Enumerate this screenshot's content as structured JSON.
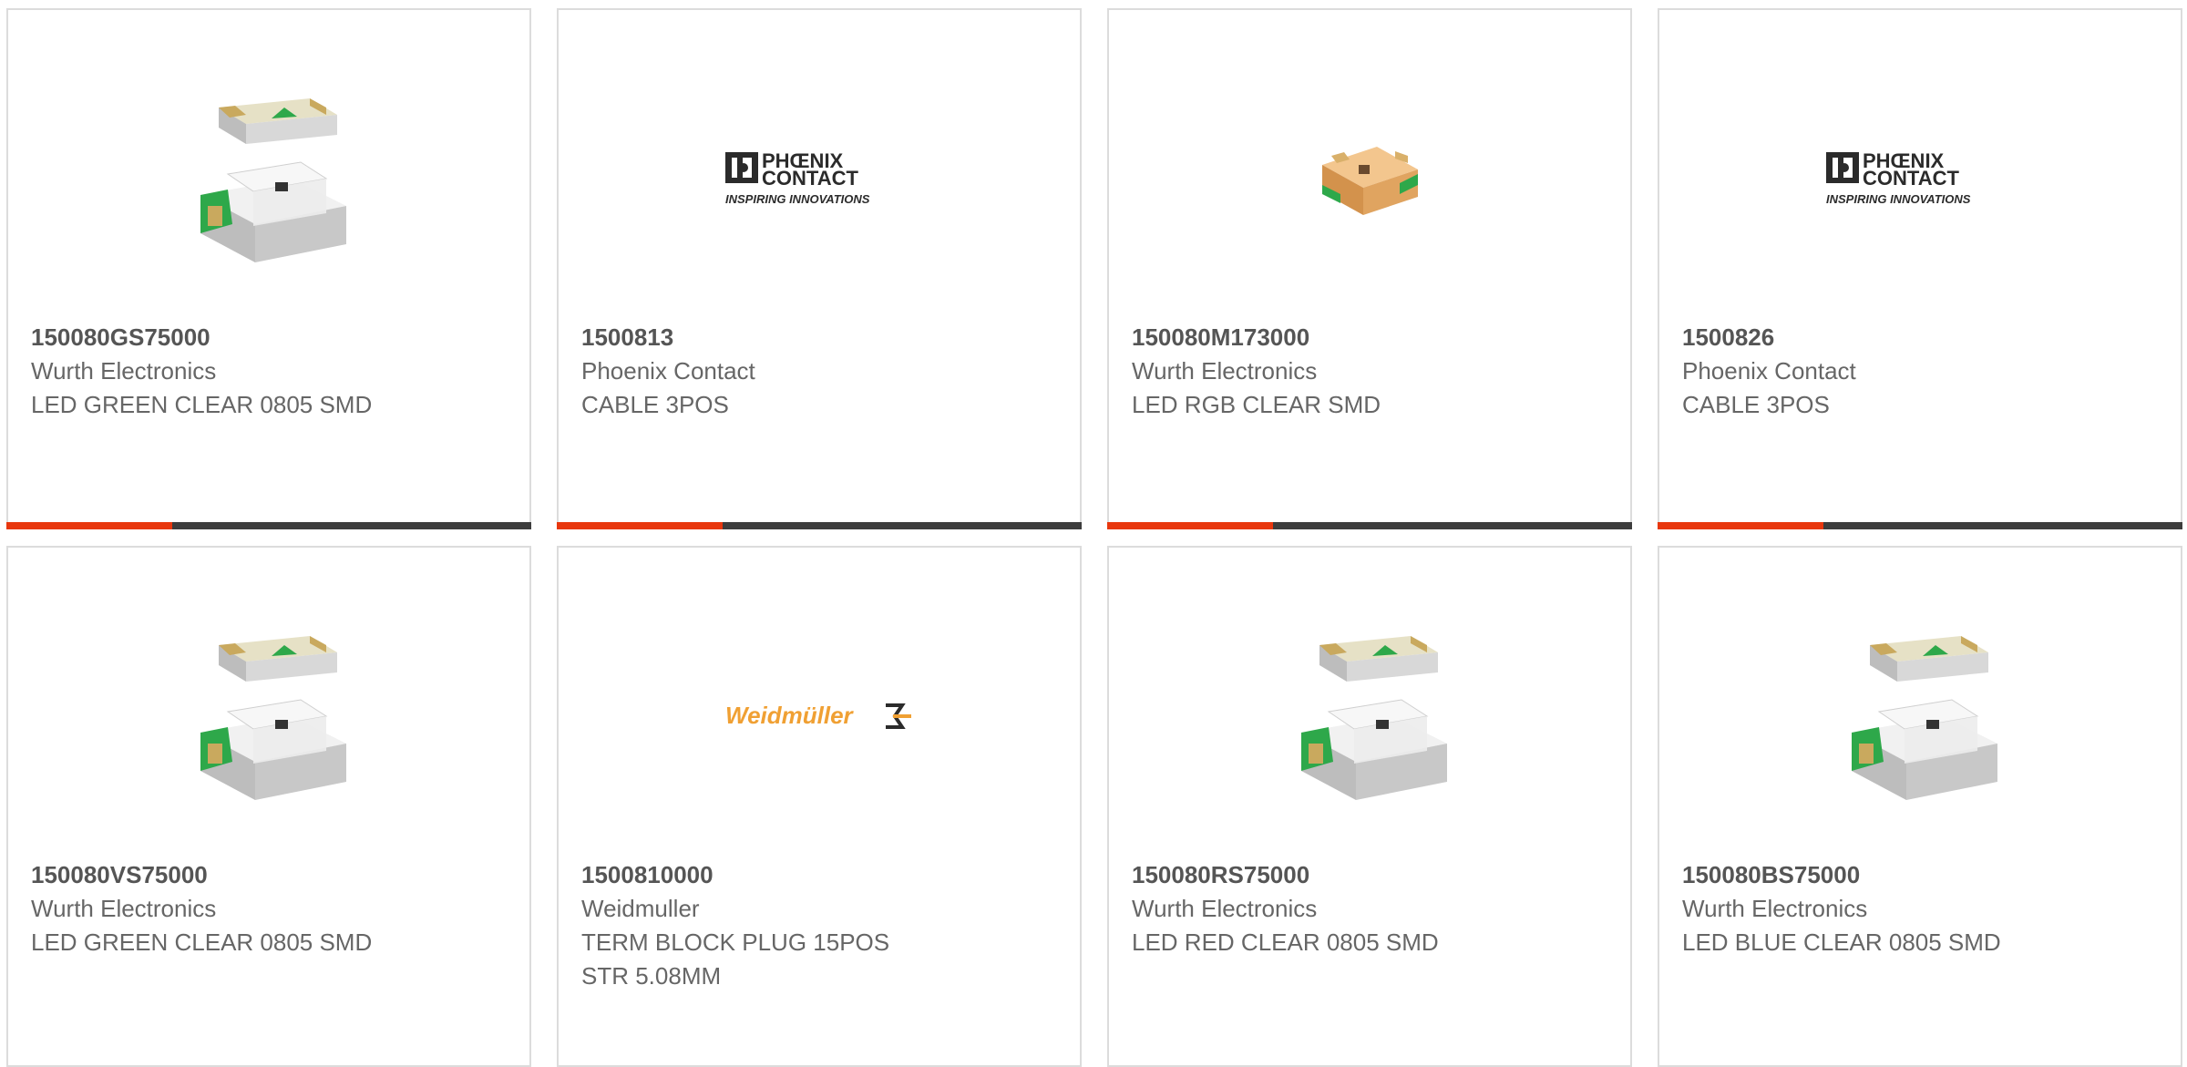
{
  "colors": {
    "accent": "#e8370e",
    "bar": "#3d3d3d",
    "border": "#dcdcdc"
  },
  "products": [
    {
      "part_number": "150080GS75000",
      "manufacturer": "Wurth Electronics",
      "desc1": "LED GREEN CLEAR 0805 SMD",
      "desc2": "",
      "image": "led-green-icon"
    },
    {
      "part_number": "1500813",
      "manufacturer": "Phoenix Contact",
      "desc1": "CABLE 3POS",
      "desc2": "",
      "image": "phoenix-contact-logo",
      "logo_line1": "PHŒNIX",
      "logo_line2": "CONTACT",
      "logo_tag": "INSPIRING INNOVATIONS"
    },
    {
      "part_number": "150080M173000",
      "manufacturer": "Wurth Electronics",
      "desc1": "LED RGB CLEAR SMD",
      "desc2": "",
      "image": "led-rgb-icon"
    },
    {
      "part_number": "1500826",
      "manufacturer": "Phoenix Contact",
      "desc1": "CABLE 3POS",
      "desc2": "",
      "image": "phoenix-contact-logo",
      "logo_line1": "PHŒNIX",
      "logo_line2": "CONTACT",
      "logo_tag": "INSPIRING INNOVATIONS"
    },
    {
      "part_number": "150080VS75000",
      "manufacturer": "Wurth Electronics",
      "desc1": "LED GREEN CLEAR 0805 SMD",
      "desc2": "",
      "image": "led-green-icon"
    },
    {
      "part_number": "1500810000",
      "manufacturer": "Weidmuller",
      "desc1": "TERM BLOCK PLUG 15POS",
      "desc2": "STR 5.08MM",
      "image": "weidmuller-logo",
      "logo_text": "Weidmüller"
    },
    {
      "part_number": "150080RS75000",
      "manufacturer": "Wurth Electronics",
      "desc1": "LED RED CLEAR 0805 SMD",
      "desc2": "",
      "image": "led-red-icon"
    },
    {
      "part_number": "150080BS75000",
      "manufacturer": "Wurth Electronics",
      "desc1": "LED BLUE CLEAR 0805 SMD",
      "desc2": "",
      "image": "led-blue-icon"
    }
  ]
}
